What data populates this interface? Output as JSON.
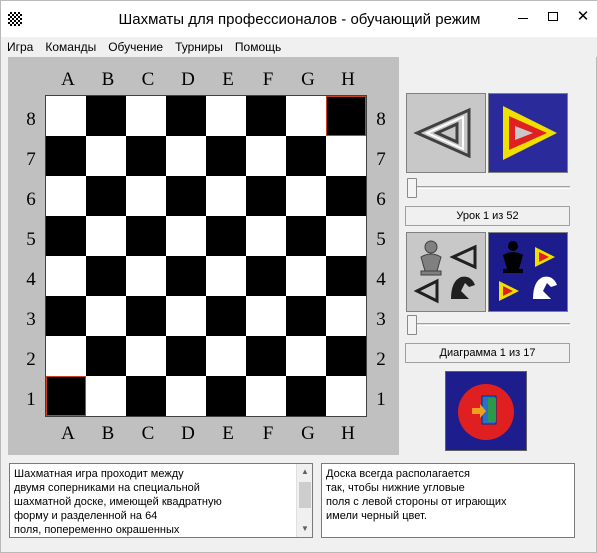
{
  "window": {
    "title": "Шахматы для профессионалов -  обучающий режим",
    "minimize_icon": "minimize-icon",
    "maximize_icon": "maximize-icon",
    "close_glyph": "✕"
  },
  "menu": {
    "items": [
      {
        "label": "Игра"
      },
      {
        "label": "Команды"
      },
      {
        "label": "Обучение"
      },
      {
        "label": "Турниры"
      },
      {
        "label": "Помощь"
      }
    ]
  },
  "board": {
    "files": [
      "A",
      "B",
      "C",
      "D",
      "E",
      "F",
      "G",
      "H"
    ],
    "ranks": [
      "8",
      "7",
      "6",
      "5",
      "4",
      "3",
      "2",
      "1"
    ],
    "highlighted_squares": [
      "h8",
      "a1"
    ],
    "light_color": "#ffffff",
    "dark_color": "#000000",
    "highlight_color": "#c8401e"
  },
  "lessons": {
    "status_text": "Урок 1 из 52",
    "slider_value": 1
  },
  "diagrams": {
    "status_text": "Диаграмма 1 из 17",
    "slider_value": 1
  },
  "buttons": {
    "lesson_back_icon": "triangle-back-icon",
    "lesson_forward_icon": "triangle-forward-icon",
    "diagram_back_icon": "pieces-back-icon",
    "diagram_forward_icon": "pieces-forward-icon",
    "exit_icon": "exit-door-icon"
  },
  "text_left": {
    "lines": [
      "Шахматная игра проходит между",
      "двумя соперниками на специальной",
      "шахматной доске, имеющей квадратную",
      "форму и разделенной на 64",
      "поля, попеременно окрашенных"
    ]
  },
  "text_right": {
    "lines": [
      "Доска всегда располагается",
      "так, чтобы нижние угловые",
      "поля с левой стороны от играющих",
      "имели черный цвет."
    ]
  },
  "colors": {
    "accent_blue": "#2a2a9a",
    "accent_yellow": "#f0e000",
    "accent_red": "#e02020"
  }
}
